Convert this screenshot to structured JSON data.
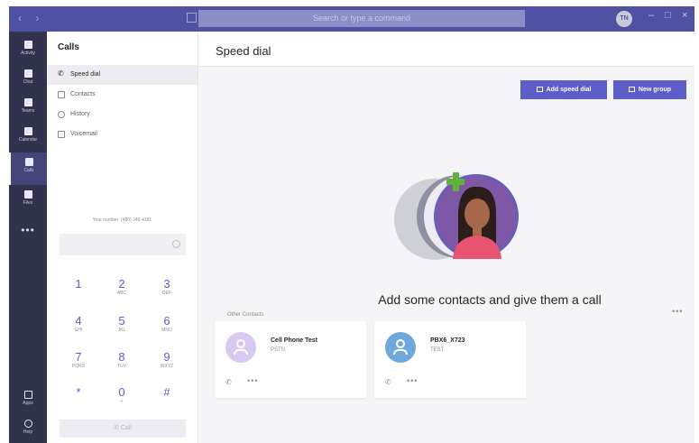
{
  "titlebar": {
    "nav_arrows": "‹ ›",
    "search_placeholder": "Search or type a command",
    "avatar_initials": "TN",
    "minimize": "–",
    "maximize": "□",
    "close": "×"
  },
  "rail": {
    "items": [
      {
        "label": "Activity",
        "icon": "bell-icon"
      },
      {
        "label": "Chat",
        "icon": "chat-icon"
      },
      {
        "label": "Teams",
        "icon": "teams-icon"
      },
      {
        "label": "Calendar",
        "icon": "calendar-icon"
      },
      {
        "label": "Calls",
        "icon": "phone-icon"
      },
      {
        "label": "Files",
        "icon": "file-icon"
      }
    ],
    "more": "•••",
    "apps_label": "Apps",
    "help_label": "Help"
  },
  "panel": {
    "title": "Calls",
    "nav": [
      {
        "label": "Speed dial",
        "icon": "phone-icon"
      },
      {
        "label": "Contacts",
        "icon": "contacts-icon"
      },
      {
        "label": "History",
        "icon": "history-icon"
      },
      {
        "label": "Voicemail",
        "icon": "voicemail-icon"
      }
    ],
    "your_number": "Your number: (480) 245-4181",
    "call_label": "Call"
  },
  "dialpad": [
    {
      "digit": "1",
      "letters": ""
    },
    {
      "digit": "2",
      "letters": "ABC"
    },
    {
      "digit": "3",
      "letters": "DEF"
    },
    {
      "digit": "4",
      "letters": "GHI"
    },
    {
      "digit": "5",
      "letters": "JKL"
    },
    {
      "digit": "6",
      "letters": "MNO"
    },
    {
      "digit": "7",
      "letters": "PQRS"
    },
    {
      "digit": "8",
      "letters": "TUV"
    },
    {
      "digit": "9",
      "letters": "WXYZ"
    },
    {
      "digit": "*",
      "letters": ""
    },
    {
      "digit": "0",
      "letters": "+"
    },
    {
      "digit": "#",
      "letters": ""
    }
  ],
  "main": {
    "title": "Speed dial",
    "add_speed_dial": "Add speed dial",
    "new_group": "New group",
    "empty_message": "Add some contacts and give them a call",
    "other_contacts_label": "Other Contacts",
    "more": "•••"
  },
  "contacts": [
    {
      "name": "Cell Phone Test",
      "subtitle": "PSTN",
      "avatar_color": "#d9c9f0"
    },
    {
      "name": "PBX6_X723",
      "subtitle": "TEST",
      "avatar_color": "#6fa8dc"
    }
  ],
  "colors": {
    "titlebar": "#4f52a3",
    "rail": "#31324d",
    "accent": "#5b5fc7"
  }
}
